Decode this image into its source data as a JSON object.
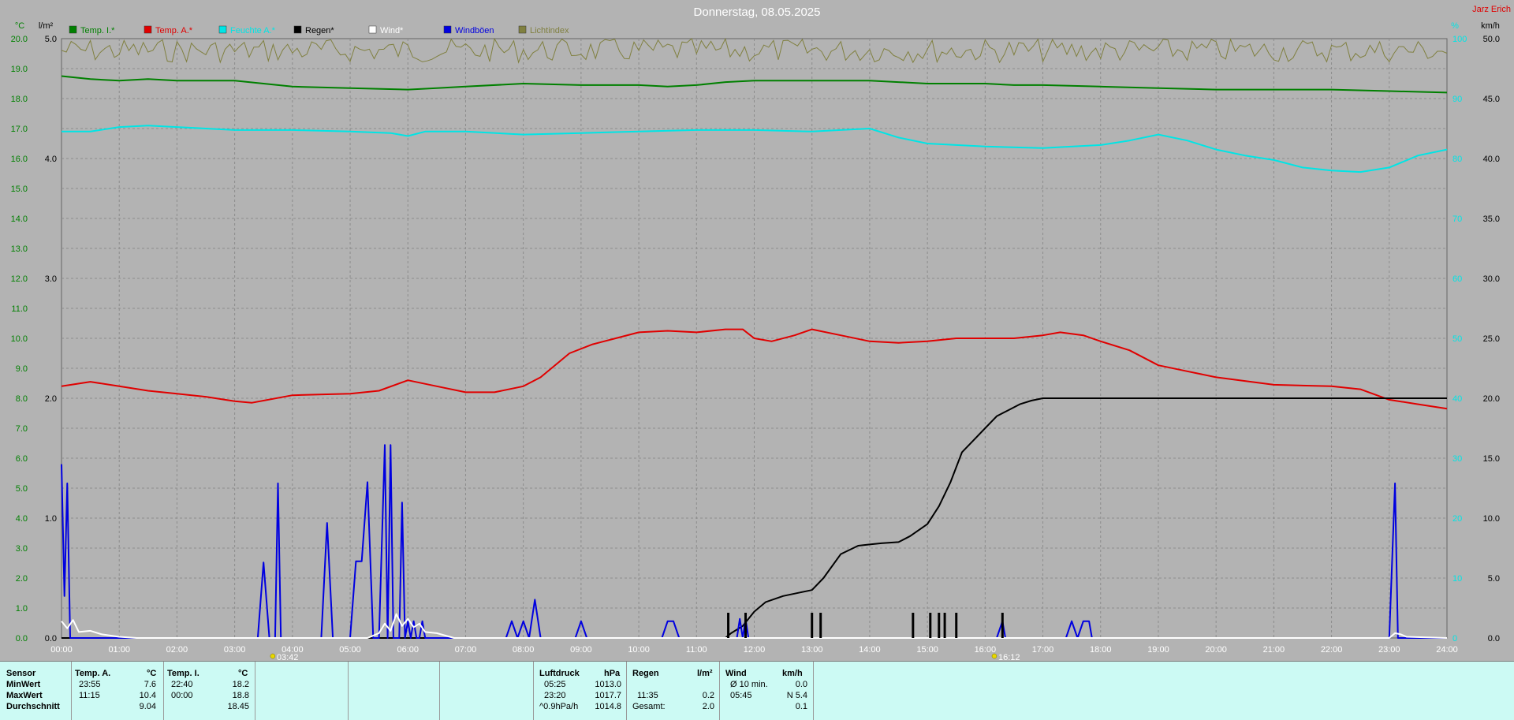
{
  "page": {
    "title": "Donnerstag, 08.05.2025",
    "station_label": "Jarz Erich",
    "colors": {
      "background": "#b3b3b3",
      "stats_panel": "#ccfaf4",
      "title": "#ffffff",
      "station": "#e00000"
    }
  },
  "chart_data": {
    "type": "line",
    "x_ticks": [
      "00:00",
      "01:00",
      "02:00",
      "03:00",
      "04:00",
      "05:00",
      "06:00",
      "07:00",
      "08:00",
      "09:00",
      "10:00",
      "11:00",
      "12:00",
      "13:00",
      "14:00",
      "15:00",
      "16:00",
      "17:00",
      "18:00",
      "19:00",
      "20:00",
      "21:00",
      "22:00",
      "23:00",
      "24:00"
    ],
    "x_range_hours": [
      0,
      24
    ],
    "grid": true,
    "axes": {
      "temp": {
        "label": "°C",
        "range": [
          0,
          20
        ],
        "ticks": [
          "0.0",
          "1.0",
          "2.0",
          "3.0",
          "4.0",
          "5.0",
          "6.0",
          "7.0",
          "8.0",
          "9.0",
          "10.0",
          "11.0",
          "12.0",
          "13.0",
          "14.0",
          "15.0",
          "16.0",
          "17.0",
          "18.0",
          "19.0",
          "20.0"
        ],
        "color": "#008000"
      },
      "rain": {
        "label": "l/m²",
        "range": [
          0,
          5
        ],
        "ticks": [
          "0.0",
          "1.0",
          "2.0",
          "3.0",
          "4.0",
          "5.0"
        ],
        "color": "#000000"
      },
      "percent": {
        "label": "%",
        "range": [
          0,
          100
        ],
        "ticks": [
          "0",
          "10",
          "20",
          "30",
          "40",
          "50",
          "60",
          "70",
          "80",
          "90",
          "100"
        ],
        "color": "#00e5e5"
      },
      "wind": {
        "label": "km/h",
        "range": [
          0,
          50
        ],
        "ticks": [
          "0.0",
          "5.0",
          "10.0",
          "15.0",
          "20.0",
          "25.0",
          "30.0",
          "35.0",
          "40.0",
          "45.0",
          "50.0"
        ],
        "color": "#000000"
      }
    },
    "legend": [
      {
        "name": "Temp. I.*",
        "color": "#008000"
      },
      {
        "name": "Temp. A.*",
        "color": "#e00000"
      },
      {
        "name": "Feuchte A.*",
        "color": "#00e5e5"
      },
      {
        "name": "Regen*",
        "color": "#000000"
      },
      {
        "name": "Wind*",
        "color": "#ffffff"
      },
      {
        "name": "Windböen",
        "color": "#0000e0"
      },
      {
        "name": "Lichtindex",
        "color": "#808040"
      }
    ],
    "annotations": [
      {
        "label": "03:42",
        "hour": 3.7,
        "icon": "sunrise-icon"
      },
      {
        "label": "16:12",
        "hour": 16.2,
        "icon": "sunset-icon"
      }
    ],
    "series": [
      {
        "name": "Temp. I.*",
        "axis": "temp",
        "color": "#008000",
        "x": [
          0,
          0.5,
          1,
          1.5,
          2,
          3,
          3.5,
          4,
          5,
          6,
          6.5,
          7,
          8,
          9,
          10,
          10.5,
          11,
          11.5,
          12,
          13,
          14,
          15,
          16,
          16.5,
          17,
          18,
          19,
          20,
          21,
          22,
          23,
          24
        ],
        "y": [
          18.75,
          18.65,
          18.6,
          18.65,
          18.6,
          18.6,
          18.5,
          18.4,
          18.35,
          18.3,
          18.35,
          18.4,
          18.5,
          18.45,
          18.45,
          18.4,
          18.45,
          18.55,
          18.6,
          18.6,
          18.6,
          18.5,
          18.5,
          18.45,
          18.45,
          18.4,
          18.35,
          18.3,
          18.3,
          18.3,
          18.25,
          18.2
        ]
      },
      {
        "name": "Temp. A.*",
        "axis": "temp",
        "color": "#e00000",
        "x": [
          0,
          0.5,
          1,
          1.5,
          2,
          2.5,
          3,
          3.3,
          4,
          5,
          5.5,
          6,
          6.5,
          7,
          7.5,
          8,
          8.3,
          8.8,
          9.2,
          9.6,
          10,
          10.5,
          11,
          11.5,
          11.8,
          12,
          12.3,
          12.7,
          13,
          13.5,
          14,
          14.5,
          15,
          15.5,
          16,
          16.5,
          17,
          17.3,
          17.7,
          18,
          18.5,
          19,
          19.5,
          20,
          21,
          22,
          22.5,
          23,
          23.5,
          24
        ],
        "y": [
          8.4,
          8.55,
          8.4,
          8.25,
          8.15,
          8.05,
          7.9,
          7.85,
          8.1,
          8.15,
          8.25,
          8.6,
          8.4,
          8.2,
          8.2,
          8.4,
          8.7,
          9.5,
          9.8,
          10.0,
          10.2,
          10.25,
          10.2,
          10.3,
          10.3,
          10.0,
          9.9,
          10.1,
          10.3,
          10.1,
          9.9,
          9.85,
          9.9,
          10.0,
          10.0,
          10.0,
          10.1,
          10.2,
          10.1,
          9.9,
          9.6,
          9.1,
          8.9,
          8.7,
          8.45,
          8.4,
          8.3,
          7.95,
          7.8,
          7.65
        ]
      },
      {
        "name": "Feuchte A.*",
        "axis": "temp",
        "color": "#00e5e5",
        "x": [
          0,
          0.5,
          1,
          1.5,
          2,
          3,
          4,
          5,
          5.7,
          6,
          6.3,
          7,
          8,
          9,
          10,
          11,
          12,
          13,
          14,
          14.5,
          15,
          15.5,
          16,
          17,
          18,
          18.5,
          19,
          19.5,
          20,
          20.5,
          21,
          21.5,
          22,
          22.5,
          23,
          23.5,
          24
        ],
        "y": [
          16.9,
          16.9,
          17.05,
          17.1,
          17.05,
          16.95,
          16.95,
          16.9,
          16.85,
          16.75,
          16.9,
          16.9,
          16.8,
          16.85,
          16.9,
          16.95,
          16.95,
          16.9,
          17.0,
          16.7,
          16.5,
          16.45,
          16.4,
          16.35,
          16.45,
          16.6,
          16.8,
          16.6,
          16.3,
          16.1,
          15.95,
          15.7,
          15.6,
          15.55,
          15.7,
          16.1,
          16.3
        ]
      },
      {
        "name": "Regen*",
        "axis": "rain",
        "color": "#000000",
        "x": [
          0,
          11.5,
          11.6,
          11.8,
          12,
          12.2,
          12.5,
          12.8,
          13,
          13.2,
          13.5,
          13.8,
          14,
          14.2,
          14.5,
          14.7,
          15,
          15.2,
          15.4,
          15.6,
          15.8,
          16,
          16.2,
          16.4,
          16.6,
          16.8,
          17,
          18,
          24
        ],
        "y": [
          0,
          0,
          0.04,
          0.1,
          0.22,
          0.3,
          0.35,
          0.38,
          0.4,
          0.5,
          0.7,
          0.77,
          0.78,
          0.79,
          0.8,
          0.85,
          0.95,
          1.1,
          1.3,
          1.55,
          1.65,
          1.75,
          1.85,
          1.9,
          1.95,
          1.98,
          2.0,
          2.0,
          2.0
        ]
      },
      {
        "name": "Windböen",
        "axis": "wind",
        "color": "#0000e0",
        "x": [
          0,
          0.05,
          0.1,
          0.15,
          0.2,
          0.25,
          0.3,
          3.4,
          3.5,
          3.6,
          3.7,
          3.75,
          3.8,
          4.5,
          4.6,
          4.7,
          5.0,
          5.1,
          5.2,
          5.3,
          5.4,
          5.5,
          5.6,
          5.65,
          5.7,
          5.75,
          5.85,
          5.9,
          5.95,
          6.0,
          6.05,
          6.1,
          6.15,
          6.2,
          6.25,
          6.3,
          7.7,
          7.8,
          7.9,
          8.0,
          8.1,
          8.2,
          8.3,
          8.35,
          8.9,
          9.0,
          9.1,
          10.4,
          10.5,
          10.6,
          10.7,
          11.7,
          11.75,
          11.8,
          11.85,
          11.9,
          16.2,
          16.3,
          16.35,
          16.4,
          17.4,
          17.5,
          17.6,
          17.7,
          17.8,
          17.85,
          23.0,
          23.1,
          23.15,
          23.2,
          24
        ],
        "y": [
          14.5,
          3.5,
          12.9,
          0,
          0,
          0,
          0,
          0,
          6.3,
          0,
          0,
          12.9,
          0,
          0,
          9.6,
          0,
          0,
          6.4,
          6.4,
          13.0,
          0,
          0,
          16.1,
          0,
          16.1,
          0,
          0,
          11.3,
          0,
          1.4,
          0,
          1.4,
          0,
          0,
          1.4,
          0,
          0,
          1.4,
          0,
          1.4,
          0,
          3.2,
          0,
          0,
          0,
          1.4,
          0,
          0,
          1.4,
          1.4,
          0,
          0,
          1.6,
          0,
          1.6,
          0,
          0,
          1.4,
          0,
          0,
          0,
          1.4,
          0,
          1.4,
          1.4,
          0,
          0,
          12.9,
          0,
          0,
          0
        ]
      },
      {
        "name": "Wind*",
        "axis": "wind",
        "color": "#ffffff",
        "x": [
          0,
          0.1,
          0.2,
          0.3,
          0.5,
          0.7,
          1.0,
          1.3,
          5.3,
          5.5,
          5.6,
          5.7,
          5.8,
          5.9,
          6.0,
          6.1,
          6.2,
          6.3,
          6.5,
          6.8,
          23.0,
          23.1,
          23.2,
          23.3,
          24
        ],
        "y": [
          1.4,
          0.8,
          1.5,
          0.5,
          0.6,
          0.3,
          0.1,
          0,
          0,
          0.4,
          1.2,
          0.6,
          2.0,
          1.0,
          1.6,
          0.9,
          1.2,
          0.5,
          0.4,
          0,
          0,
          0.4,
          0.3,
          0.1,
          0
        ]
      },
      {
        "name": "Lichtindex",
        "axis": "percent",
        "color": "#808040",
        "pattern": "noise-near-top",
        "min": 96,
        "max": 100
      }
    ],
    "rain_event_bars": [
      11.55,
      11.85,
      13.0,
      13.15,
      14.75,
      15.05,
      15.2,
      15.3,
      15.5,
      16.3
    ]
  },
  "stats": {
    "sensor": {
      "header": "Sensor",
      "min": "MinWert",
      "max": "MaxWert",
      "avg": "Durchschnitt"
    },
    "temp_a": {
      "header": "Temp. A.",
      "unit": "°C",
      "min_time": "23:55",
      "min_val": "7.6",
      "max_time": "11:15",
      "max_val": "10.4",
      "avg_val": "9.04"
    },
    "temp_i": {
      "header": "Temp. I.",
      "unit": "°C",
      "min_time": "22:40",
      "min_val": "18.2",
      "max_time": "00:00",
      "max_val": "18.8",
      "avg_val": "18.45"
    },
    "pressure": {
      "header": "Luftdruck",
      "unit": "hPa",
      "min_time": "05:25",
      "min_val": "1013.0",
      "max_time": "23:20",
      "max_val": "1017.7",
      "trend_label": "^0.9hPa/h",
      "avg_val": "1014.8"
    },
    "rain": {
      "header": "Regen",
      "unit": "l/m²",
      "max_time": "11:35",
      "max_val": "0.2",
      "total_label": "Gesamt:",
      "total_val": "2.0"
    },
    "wind": {
      "header": "Wind",
      "unit": "km/h",
      "min_label": "Ø 10 min.",
      "min_val": "0.0",
      "max_time": "05:45",
      "max_val": "N 5.4",
      "avg_val": "0.1"
    }
  }
}
